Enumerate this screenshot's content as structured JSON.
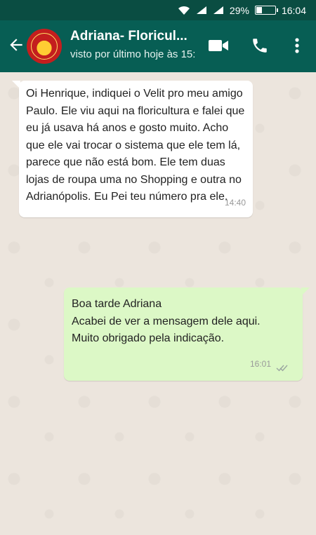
{
  "status_bar": {
    "battery_percent": "29%",
    "time": "16:04",
    "battery_level": 0.29
  },
  "header": {
    "contact_name": "Adriana- Floricul...",
    "last_seen": "visto por último hoje às 15:"
  },
  "messages": [
    {
      "direction": "incoming",
      "text": "Oi Henrique, indiquei o Velit pro meu amigo Paulo. Ele viu aqui na floricultura e falei que eu já usava há anos e gosto muito. Acho que ele vai trocar o sistema que ele tem lá, parece que não está bom. Ele tem duas lojas de roupa uma no Shopping e outra no Adrianópolis. Eu Pei teu número pra ele.",
      "time": "14:40"
    },
    {
      "direction": "outgoing",
      "text": "Boa tarde Adriana\nAcabei de ver a mensagem dele aqui.\nMuito obrigado pela indicação.",
      "time": "16:01",
      "status": "read"
    }
  ],
  "colors": {
    "header": "#075e54",
    "status_bar": "#0a4d42",
    "outgoing_bubble": "#dcf8c6",
    "incoming_bubble": "#ffffff",
    "chat_bg": "#ece5dd"
  }
}
